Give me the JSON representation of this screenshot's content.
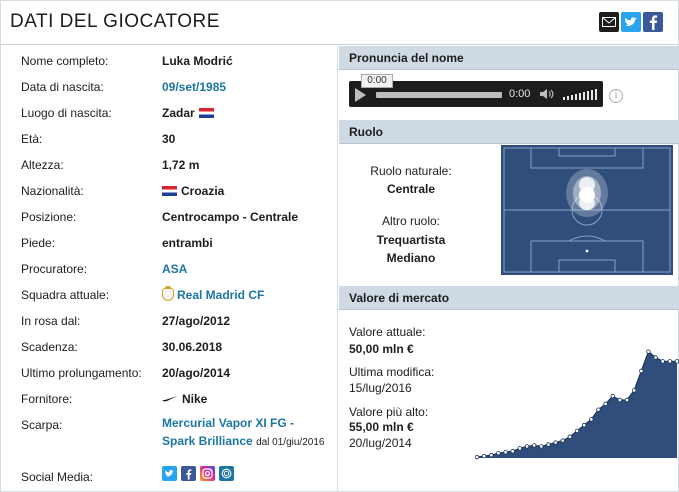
{
  "header": {
    "title": "DATI DEL GIOCATORE",
    "share_icons": [
      "mail-icon",
      "twitter-icon",
      "facebook-icon"
    ]
  },
  "profile": {
    "full_name_label": "Nome completo:",
    "full_name": "Luka Modrić",
    "birth_date_label": "Data di nascita:",
    "birth_date": "09/set/1985",
    "birth_place_label": "Luogo di nascita:",
    "birth_place": "Zadar",
    "age_label": "Età:",
    "age": "30",
    "height_label": "Altezza:",
    "height": "1,72 m",
    "nationality_label": "Nazionalità:",
    "nationality": "Croazia",
    "position_label": "Posizione:",
    "position": "Centrocampo - Centrale",
    "foot_label": "Piede:",
    "foot": "entrambi",
    "agent_label": "Procuratore:",
    "agent": "ASA",
    "club_label": "Squadra attuale:",
    "club": "Real Madrid CF",
    "joined_label": "In rosa dal:",
    "joined": "27/ago/2012",
    "contract_label": "Scadenza:",
    "contract": "30.06.2018",
    "extension_label": "Ultimo prolungamento:",
    "extension": "20/ago/2014",
    "supplier_label": "Fornitore:",
    "supplier": "Nike",
    "boot_label": "Scarpa:",
    "boot": "Mercurial Vapor XI FG - Spark Brilliance",
    "boot_since": "dal 01/giu/2016",
    "social_label": "Social Media:",
    "social_icons": [
      "twitter-icon",
      "facebook-icon",
      "instagram-icon",
      "website-icon"
    ]
  },
  "pronunciation": {
    "title": "Pronuncia del nome",
    "tooltip": "0:00",
    "time": "0:00"
  },
  "role": {
    "title": "Ruolo",
    "natural_label": "Ruolo naturale:",
    "natural": "Centrale",
    "other_label": "Altro ruolo:",
    "other_1": "Trequartista",
    "other_2": "Mediano"
  },
  "market_value": {
    "title": "Valore di mercato",
    "current_label": "Valore attuale:",
    "current": "50,00 mln €",
    "last_change_label": "Ultima modifica:",
    "last_change": "15/lug/2016",
    "highest_label": "Valore più alto:",
    "highest": "55,00 mln €",
    "highest_date": "20/lug/2014",
    "colors": {
      "area": "#2f4e7c",
      "line": "#1d3557",
      "marker": "#ffffff"
    }
  },
  "chart_data": {
    "type": "area",
    "title": "",
    "xlabel": "",
    "ylabel": "",
    "y": [
      0.5,
      1,
      1.5,
      2.5,
      3,
      3.5,
      5,
      6,
      6.5,
      6,
      7,
      8,
      9,
      11,
      14,
      17,
      20,
      25,
      28,
      32,
      30,
      30,
      35,
      45,
      55,
      52,
      50,
      50,
      50
    ],
    "ylim": [
      0,
      60
    ],
    "grid": false,
    "legend": "none"
  }
}
